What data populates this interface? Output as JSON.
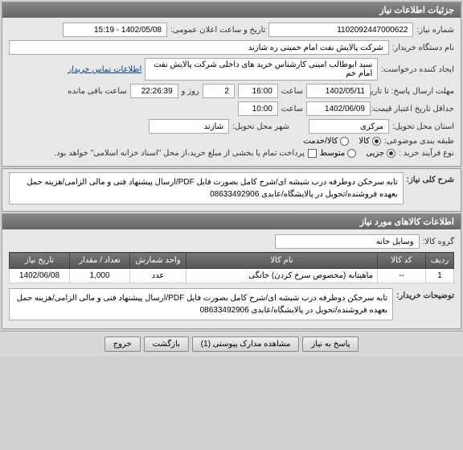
{
  "header": {
    "title": "جزئیات اطلاعات نیاز"
  },
  "info": {
    "need_no_label": "شماره نیاز:",
    "need_no": "1102092447000622",
    "public_date_label": "تاریخ و ساعت اعلان عمومی:",
    "public_date": "1402/05/08 - 15:19",
    "buyer_label": "نام دستگاه خریدار:",
    "buyer": "شرکت پالایش نفت امام خمینی  ره  شازند",
    "creator_label": "ایجاد کننده درخواست:",
    "creator": "سید ابوطالب  امینی کارشناس خرید های داخلی  شرکت پالایش نفت امام خم",
    "contact_link": "اطلاعات تماس خریدار",
    "deadline_send_label": "مهلت ارسال پاسخ: تا تاریخ:",
    "deadline_send_date": "1402/05/11",
    "hour_label": "ساعت",
    "deadline_send_time": "16:00",
    "days_label": "روز و",
    "days": "2",
    "remaining_time": "22:26:39",
    "remaining_label": "ساعت باقی مانده",
    "validity_label": "حداقل تاریخ اعتبار قیمت: تا تاریخ:",
    "validity_date": "1402/06/09",
    "validity_time": "10:00",
    "province_label": "استان محل تحویل:",
    "province": "مرکزی",
    "city_label": "شهر محل تحویل:",
    "city": "شازند",
    "pack_label": "طبقه بندی موضوعی:",
    "pack_item": "کالا",
    "pack_service": "کالا/خدمت",
    "buy_type_label": "نوع فرآیند خرید :",
    "opt_partial": "جزیی",
    "opt_medium": "متوسط",
    "payment_note": "پرداخت تمام یا بخشی از مبلغ خرید،از محل \"اسناد خزانه اسلامی\" خواهد بود."
  },
  "desc": {
    "header": "شرح کلی نیاز:",
    "text": "تابه سرخکن دوطرفه درب شیشه ای/شرح کامل بصورت فایل PDF/ارسال پیشنهاد فنی و مالی الزامی/هزینه حمل بعهده فروشنده/تحویل در پالایشگاه/عابدی 08633492906"
  },
  "items": {
    "header": "اطلاعات کالاهای مورد نیاز",
    "group_label": "گروه کالا:",
    "group_value": "وسایل خانه",
    "cols": {
      "row": "ردیف",
      "code": "کد کالا",
      "name": "نام کالا",
      "unit": "واحد شمارش",
      "qty": "تعداد / مقدار",
      "date": "تاریخ نیاز"
    },
    "rows": [
      {
        "row": "1",
        "code": "--",
        "name": "ماهیتابه (مخصوص سرخ کردن) خانگی",
        "unit": "عدد",
        "qty": "1,000",
        "date": "1402/06/08"
      }
    ],
    "buyer_note_label": "توضیحات خریدار:",
    "buyer_note": "تابه سرخکن دوطرفه درب شیشه ای/شرح کامل بصورت فایل PDF/ارسال پیشنهاد فنی و مالی الزامی/هزینه حمل بعهده فروشنده/تحویل در پالایشگاه/عابدی 08633492906"
  },
  "footer": {
    "respond": "پاسخ به نیاز",
    "attachments": "مشاهده مدارک پیوستی (1)",
    "back": "بازگشت",
    "exit": "خروج"
  }
}
